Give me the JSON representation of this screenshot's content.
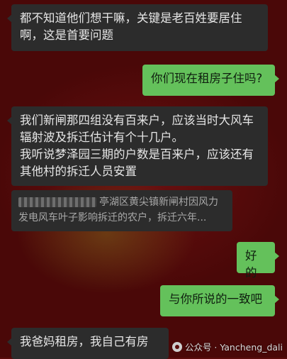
{
  "messages": [
    {
      "side": "in",
      "text": "都不知道他们想干嘛，关键是老百姓要居住啊，这是首要问题"
    },
    {
      "side": "out",
      "text": "你们现在租房子住吗?"
    },
    {
      "side": "in",
      "text": "我们新闸那四组没有百来户，应该当时大风车辐射波及拆迁估计有个十几户。\n我听说梦泽园三期的户数是百来户，应该还有其他村的拆迁人员安置"
    },
    {
      "side": "out",
      "text": "好的"
    },
    {
      "side": "out",
      "text": "与你所说的一致吧"
    },
    {
      "side": "in",
      "text": "我爸妈租房，我自己有房"
    }
  ],
  "quote_card": {
    "text": "亭湖区黄尖镇新闸村因风力发电风车叶子影响拆迁的农户，拆迁六年..."
  },
  "watermark": {
    "text": "公众号 · Yancheng_dali"
  },
  "colors": {
    "incoming_bubble": "#2c2c2c",
    "outgoing_bubble": "#64c15b",
    "background": "#5a0c0c"
  }
}
